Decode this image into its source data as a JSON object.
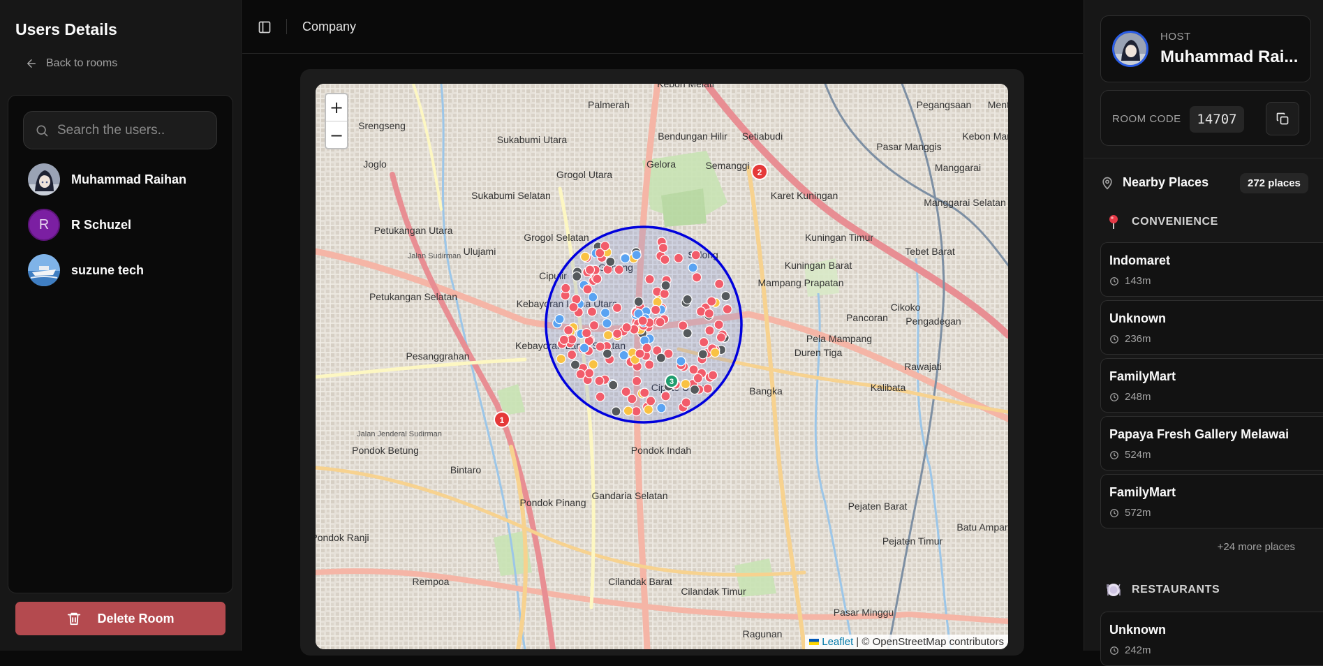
{
  "sidebar": {
    "title": "Users Details",
    "back_label": "Back to rooms",
    "search_placeholder": "Search the users..",
    "users": [
      {
        "name": "Muhammad Raihan",
        "avatar": "anime-avatar"
      },
      {
        "name": "R Schuzel",
        "avatar": "letter",
        "initial": "R",
        "color": "#7b1fa2"
      },
      {
        "name": "suzune tech",
        "avatar": "boat-avatar"
      }
    ],
    "delete_label": "Delete Room"
  },
  "header": {
    "breadcrumb": "Company"
  },
  "map": {
    "zoom_in": "+",
    "zoom_out": "−",
    "attribution_link": "Leaflet",
    "attribution_text": "| © OpenStreetMap contributors",
    "place_labels": [
      "Kebon Melati",
      "Palmerah",
      "Menteng",
      "Pegangsaan",
      "Srengseng",
      "Bendungan Hilir",
      "Setiabudi",
      "Sukabumi Utara",
      "Pasar Manggis",
      "Kebon Manggis",
      "Grogol Utara",
      "Gelora",
      "Semanggi",
      "Manggarai",
      "Joglo",
      "Sukabumi Selatan",
      "Karet Kuningan",
      "Manggarai Selatan",
      "Petukangan Utara",
      "Ulujami",
      "Grogol Selatan",
      "Kuningan Timur",
      "Tebet Barat",
      "Selong",
      "Kuningan Barat",
      "Cipulir",
      "Gunung",
      "Mampang Prapatan",
      "Petukangan Selatan",
      "Kebayoran Lama Utara",
      "Cikoko",
      "Pancoran",
      "Pengadegan",
      "Pela Mampang",
      "Kebayoran Lama Selatan",
      "Duren Tiga",
      "Pesanggrahan",
      "Rawajati",
      "Cipete Utara",
      "Kalibata",
      "Bangka",
      "Pondok Betung",
      "Pondok Indah",
      "Bintaro",
      "Gandaria Selatan",
      "Pondok Pinang",
      "Pejaten Barat",
      "Batu Ampar",
      "Pondok Ranji",
      "Pejaten Timur",
      "Rempoa",
      "Cilandak Barat",
      "Cilandak Timur",
      "Pasar Minggu",
      "Ragunan",
      "Jalan Sudirman",
      "Jalan Jenderal Sudirman"
    ],
    "cluster_badges": [
      "1",
      "2",
      "3"
    ]
  },
  "host": {
    "label": "HOST",
    "name": "Muhammad Rai..."
  },
  "room": {
    "code_label": "ROOM CODE",
    "code": "14707"
  },
  "nearby": {
    "title": "Nearby Places",
    "count": "272 places",
    "categories": [
      {
        "name": "CONVENIENCE",
        "icon": "pin-icon",
        "places": [
          {
            "name": "Indomaret",
            "distance": "143m"
          },
          {
            "name": "Unknown",
            "distance": "236m"
          },
          {
            "name": "FamilyMart",
            "distance": "248m"
          },
          {
            "name": "Papaya Fresh Gallery Melawai",
            "distance": "524m"
          },
          {
            "name": "FamilyMart",
            "distance": "572m"
          }
        ],
        "more": "+24 more places"
      },
      {
        "name": "RESTAURANTS",
        "icon": "plate-icon",
        "places": [
          {
            "name": "Unknown",
            "distance": "242m"
          }
        ]
      }
    ]
  },
  "colors": {
    "delete_bg": "#b44a4f",
    "host_ring": "#2b5ee8",
    "radius_circle": "#0000dd",
    "marker_red": "#f25c6a",
    "marker_yellow": "#f9c243",
    "marker_gray": "#55595c",
    "marker_blue": "#5aa3f2"
  }
}
